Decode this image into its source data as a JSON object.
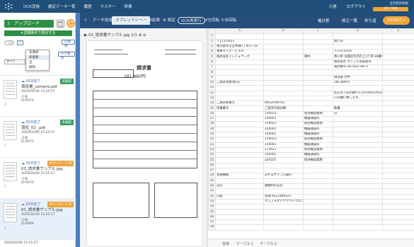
{
  "header": {
    "nav": [
      "OCR変換",
      "確定データ一覧",
      "履歴",
      "マスター",
      "辞書"
    ],
    "help": "ヘルプ",
    "logout": "ログアウト",
    "user": "小池",
    "usage_label": "当月使用枚数",
    "usage": "47 / 500"
  },
  "sidebar": {
    "upload_label": "アップロード",
    "filter_bar": "▾ 詳細条件で表示する",
    "sort_btn": "ID昇順",
    "tag_btn": "タグ検索",
    "select_value": "すべて",
    "dropdown": [
      "未選択",
      "新着順",
      "全",
      "削除"
    ],
    "files": [
      {
        "status": "OCR完了",
        "name": "領収書_camera.pdf",
        "date": "2020/02/06 15:25:57",
        "type": "小池",
        "id": "6074",
        "tag": "未確認",
        "pages": "1"
      },
      {
        "status": "OCR完了",
        "name": "領収_02_.pdf",
        "date": "2020/02/06 15:25:57",
        "type": "小池",
        "id": "6072",
        "tag": "未確認",
        "pages": "1"
      },
      {
        "status": "OCR完了",
        "name": "03_請求書サンプル.jpg",
        "date": "2020/02/06 15:25:57",
        "type": "小池",
        "id": "6070",
        "tag": "ダウンロード済",
        "pages": "1"
      },
      {
        "status": "OCR完了",
        "name": "01_請求書サンプル.jpg",
        "date": "2020/02/06 15:25:57",
        "type": "小池",
        "id": "6064",
        "tag": "ダウンロード済",
        "pages": "1"
      }
    ],
    "last_file": "2020/02/06 15:25:57"
  },
  "toolbar": {
    "data_add": "データ追加",
    "tab_spreadsheet": "スプレッドシート",
    "ocr_result": "OCR結果",
    "settings": "設定",
    "ocr_reexec": "OCR再実行",
    "left_rotate": "左回転",
    "right_rotate": "右回転",
    "edit1": "幅分割",
    "edit2": "修正一覧",
    "edit3": "折り返",
    "csv": "CSV出力"
  },
  "doc": {
    "filename": "01_請求書サンプル.jpg  1/1",
    "title": "請求書",
    "amount": "281,880円"
  },
  "grid": {
    "cols": [
      "",
      "A",
      "B",
      "C",
      "D",
      "E"
    ],
    "rows": [
      [
        "1",
        "",
        "",
        "",
        "",
        ""
      ],
      [
        "2",
        "〒113-0033",
        "",
        "",
        "発行日",
        ""
      ],
      [
        "3",
        "東京都文京区本郷2丁目27-20",
        "",
        "",
        "",
        ""
      ],
      [
        "4",
        "本郷センタービル5F",
        "",
        "",
        "〒153-6354",
        ""
      ],
      [
        "5",
        "株式会社インフォディオ",
        "",
        "御中",
        "香川県 京都府市西市上3丁目 89番地",
        ""
      ],
      [
        "6",
        "",
        "",
        "",
        "株式会社 サンプル商品販売",
        ""
      ],
      [
        "7",
        "",
        "",
        "",
        "電話番号 08-542(-4873",
        ""
      ],
      [
        "8",
        "",
        "",
        "",
        "",
        ""
      ],
      [
        "9",
        "",
        "",
        "",
        "請求書 合中",
        ""
      ],
      [
        "10",
        "ご請求金額(税込)",
        "",
        "",
        "281,880円",
        ""
      ],
      [
        "11",
        "",
        "",
        "",
        "",
        ""
      ],
      [
        "12",
        "",
        "",
        "",
        "前込は下記の銀行に2019年02月28日まで",
        ""
      ],
      [
        "13",
        "",
        "",
        "",
        "にお願い致します。",
        ""
      ],
      [
        "14",
        "ご請求者番号",
        "D652E98763",
        "",
        "",
        ""
      ],
      [
        "15",
        "部署番号",
        "ご請求内容詳細",
        "",
        "数量",
        ""
      ],
      [
        "16",
        "",
        "156023",
        "宿谷輸送業務",
        "日",
        ""
      ],
      [
        "17",
        "",
        "144001",
        "機器運賃料",
        "",
        ""
      ],
      [
        "18",
        "",
        "159023",
        "宿谷輸送業務",
        "",
        ""
      ],
      [
        "19",
        "",
        "144001",
        "機器運賃料",
        "",
        ""
      ],
      [
        "20",
        "",
        "144001",
        "機器運賃料",
        "",
        ""
      ],
      [
        "21",
        "",
        "159023",
        "宿谷輸送業務",
        "",
        ""
      ],
      [
        "22",
        "",
        "144001",
        "機器運賃料",
        "",
        ""
      ],
      [
        "23",
        "",
        "173621",
        "宿谷輸送業務",
        "",
        ""
      ],
      [
        "24",
        "",
        "144001",
        "機器運賃料",
        "",
        ""
      ],
      [
        "25",
        "",
        "320105",
        "宿谷輸送業務",
        "",
        ""
      ],
      [
        "26",
        "",
        "",
        "",
        "",
        ""
      ],
      [
        "27",
        "",
        "",
        "",
        "",
        ""
      ],
      [
        "28",
        "金融機関",
        "みずほサンプル銀行",
        "",
        "",
        ""
      ],
      [
        "29",
        "",
        "",
        "",
        "",
        ""
      ],
      [
        "30",
        "支店",
        "農園村山支店",
        "",
        "",
        ""
      ],
      [
        "31",
        "",
        "",
        "",
        "",
        ""
      ],
      [
        "32",
        "口座",
        "普通 9512489521",
        "",
        "",
        ""
      ],
      [
        "33",
        "",
        "サンプルオクナヤウイウエン",
        "",
        "",
        ""
      ],
      [
        "34",
        "",
        "",
        "",
        "",
        ""
      ],
      [
        "35",
        "",
        "",
        "",
        "",
        ""
      ],
      [
        "36",
        "",
        "",
        "",
        "",
        ""
      ],
      [
        "37",
        "",
        "",
        "",
        "",
        ""
      ],
      [
        "38",
        "",
        "",
        "",
        "",
        ""
      ]
    ]
  },
  "sheets": {
    "all": "全体",
    "s1": "テーブル１",
    "s2": "テーブル２"
  }
}
